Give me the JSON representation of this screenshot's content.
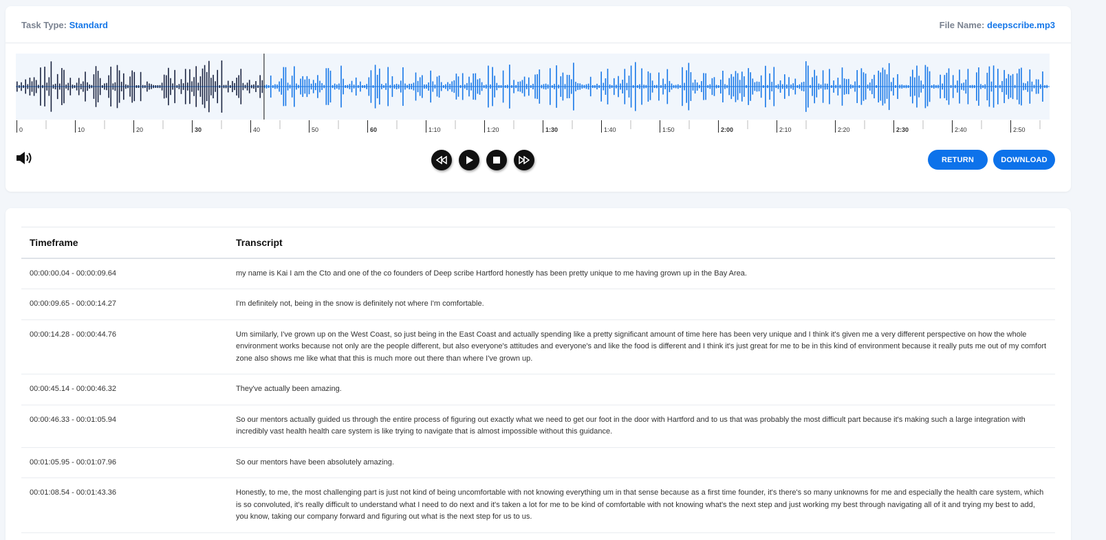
{
  "header": {
    "task_type_label": "Task Type:",
    "task_type_value": "Standard",
    "file_name_label": "File Name:",
    "file_name_value": "deepscribe.mp3"
  },
  "player": {
    "timeline_ticks": [
      "0",
      "10",
      "20",
      "30",
      "40",
      "50",
      "60",
      "1:10",
      "1:20",
      "1:30",
      "1:40",
      "1:50",
      "2:00",
      "2:10",
      "2:20",
      "2:30",
      "2:40",
      "2:50"
    ],
    "bold_ticks": [
      "30",
      "60",
      "1:30",
      "2:00",
      "2:30"
    ],
    "played_color": "#1a2340",
    "unplayed_color": "#1677e8",
    "playhead_seconds": 41.5,
    "duration_seconds": 177,
    "volume_icon": "speaker-icon",
    "controls": [
      {
        "name": "rewind-button",
        "icon": "rewind-icon"
      },
      {
        "name": "play-button",
        "icon": "play-icon"
      },
      {
        "name": "stop-button",
        "icon": "stop-icon"
      },
      {
        "name": "fast-forward-button",
        "icon": "fast-forward-icon"
      }
    ],
    "return_label": "RETURN",
    "download_label": "DOWNLOAD"
  },
  "table": {
    "col_timeframe": "Timeframe",
    "col_transcript": "Transcript",
    "rows": [
      {
        "timeframe": "00:00:00.04 - 00:00:09.64",
        "transcript": "my name is Kai I am the Cto and one of the co founders of Deep scribe Hartford honestly has been pretty unique to me having grown up in the Bay Area."
      },
      {
        "timeframe": "00:00:09.65 - 00:00:14.27",
        "transcript": "I'm definitely not, being in the snow is definitely not where I'm comfortable."
      },
      {
        "timeframe": "00:00:14.28 - 00:00:44.76",
        "transcript": "Um similarly, I've grown up on the West Coast, so just being in the East Coast and actually spending like a pretty significant amount of time here has been very unique and I think it's given me a very different perspective on how the whole environment works because not only are the people different, but also everyone's attitudes and everyone's and like the food is different and I think it's just great for me to be in this kind of environment because it really puts me out of my comfort zone also shows me like what that this is much more out there than where I've grown up."
      },
      {
        "timeframe": "00:00:45.14 - 00:00:46.32",
        "transcript": "They've actually been amazing."
      },
      {
        "timeframe": "00:00:46.33 - 00:01:05.94",
        "transcript": "So our mentors actually guided us through the entire process of figuring out exactly what we need to get our foot in the door with Hartford and to us that was probably the most difficult part because it's making such a large integration with incredibly vast health health care system is like trying to navigate that is almost impossible without this guidance."
      },
      {
        "timeframe": "00:01:05.95 - 00:01:07.96",
        "transcript": "So our mentors have been absolutely amazing."
      },
      {
        "timeframe": "00:01:08.54 - 00:01:43.36",
        "transcript": "Honestly, to me, the most challenging part is just not kind of being uncomfortable with not knowing everything um in that sense because as a first time founder, it's there's so many unknowns for me and especially the health care system, which is so convoluted, it's really difficult to understand what I need to do next and it's taken a lot for me to be kind of comfortable with not knowing what's the next step and just working my best through navigating all of it and trying my best to add, you know, taking our company forward and figuring out what is the next step for us to us."
      }
    ]
  }
}
